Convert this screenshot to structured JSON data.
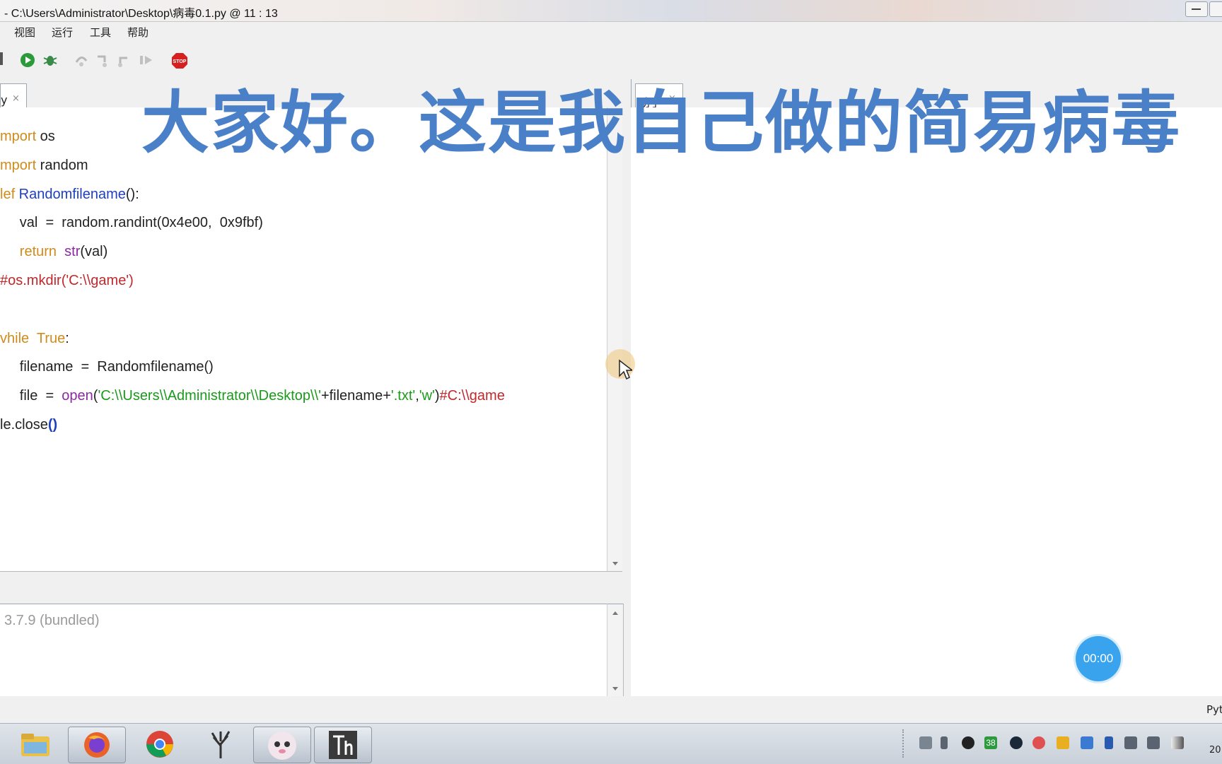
{
  "window": {
    "title": "-  C:\\Users\\Administrator\\Desktop\\病毒0.1.py  @  11 : 13"
  },
  "menu": [
    "视图",
    "运行",
    "工具",
    "帮助"
  ],
  "toolbar": {
    "icons": [
      "run-icon",
      "debug-icon",
      "step-over-icon",
      "step-into-icon",
      "step-out-icon",
      "resume-icon",
      "stop-icon"
    ],
    "stop_label": "STOP"
  },
  "tabs": [
    {
      "label": "y",
      "close": "×"
    },
    {
      "label": "助手",
      "close": "×"
    }
  ],
  "editor": {
    "lines": [
      [
        {
          "t": "mport",
          "c": "kw"
        },
        {
          "t": " os",
          "c": "blk"
        }
      ],
      [
        {
          "t": "mport",
          "c": "kw"
        },
        {
          "t": " random",
          "c": "blk"
        }
      ],
      [
        {
          "t": "lef",
          "c": "kw"
        },
        {
          "t": " Randomfilename",
          "c": "fn"
        },
        {
          "t": "():",
          "c": "blk"
        }
      ],
      [
        {
          "t": "     val  =  random.randint(0x4e00,  0x9fbf)",
          "c": "blk"
        }
      ],
      [
        {
          "t": "     ",
          "c": "blk"
        },
        {
          "t": "return",
          "c": "kw"
        },
        {
          "t": "  ",
          "c": "blk"
        },
        {
          "t": "str",
          "c": "bi"
        },
        {
          "t": "(val)",
          "c": "blk"
        }
      ],
      [
        {
          "t": "#os.mkdir('C:\\\\game')",
          "c": "red"
        }
      ],
      [],
      [
        {
          "t": "vhile",
          "c": "kw"
        },
        {
          "t": "  ",
          "c": "blk"
        },
        {
          "t": "True",
          "c": "kw"
        },
        {
          "t": ":",
          "c": "blk"
        }
      ],
      [
        {
          "t": "     filename  =  Randomfilename()",
          "c": "blk"
        }
      ],
      [
        {
          "t": "     file  =  ",
          "c": "blk"
        },
        {
          "t": "open",
          "c": "bi"
        },
        {
          "t": "(",
          "c": "blk"
        },
        {
          "t": "'C:\\\\Users\\\\Administrator\\\\Desktop\\\\'",
          "c": "str"
        },
        {
          "t": "+filename+",
          "c": "blk"
        },
        {
          "t": "'.txt'",
          "c": "str"
        },
        {
          "t": ",",
          "c": "blk"
        },
        {
          "t": "'w'",
          "c": "str"
        },
        {
          "t": ")",
          "c": "blk"
        },
        {
          "t": "#C:\\\\game",
          "c": "red"
        }
      ],
      [
        {
          "t": "le.close",
          "c": "blk"
        },
        {
          "t": "()",
          "c": "bold-blue"
        }
      ]
    ]
  },
  "shell": {
    "text": "3.7.9  (bundled)"
  },
  "status": {
    "text": "Pyt"
  },
  "overlay": {
    "caption": "大家好。这是我自己做的简易病毒"
  },
  "timer": {
    "value": "00:00"
  },
  "taskbar": {
    "apps": [
      "file-explorer-icon",
      "firefox-icon",
      "chrome-icon",
      "tree-app-icon",
      "cat-avatar-app-icon",
      "thonny-icon"
    ],
    "tray_badge": "38",
    "clock_partial": "20"
  }
}
